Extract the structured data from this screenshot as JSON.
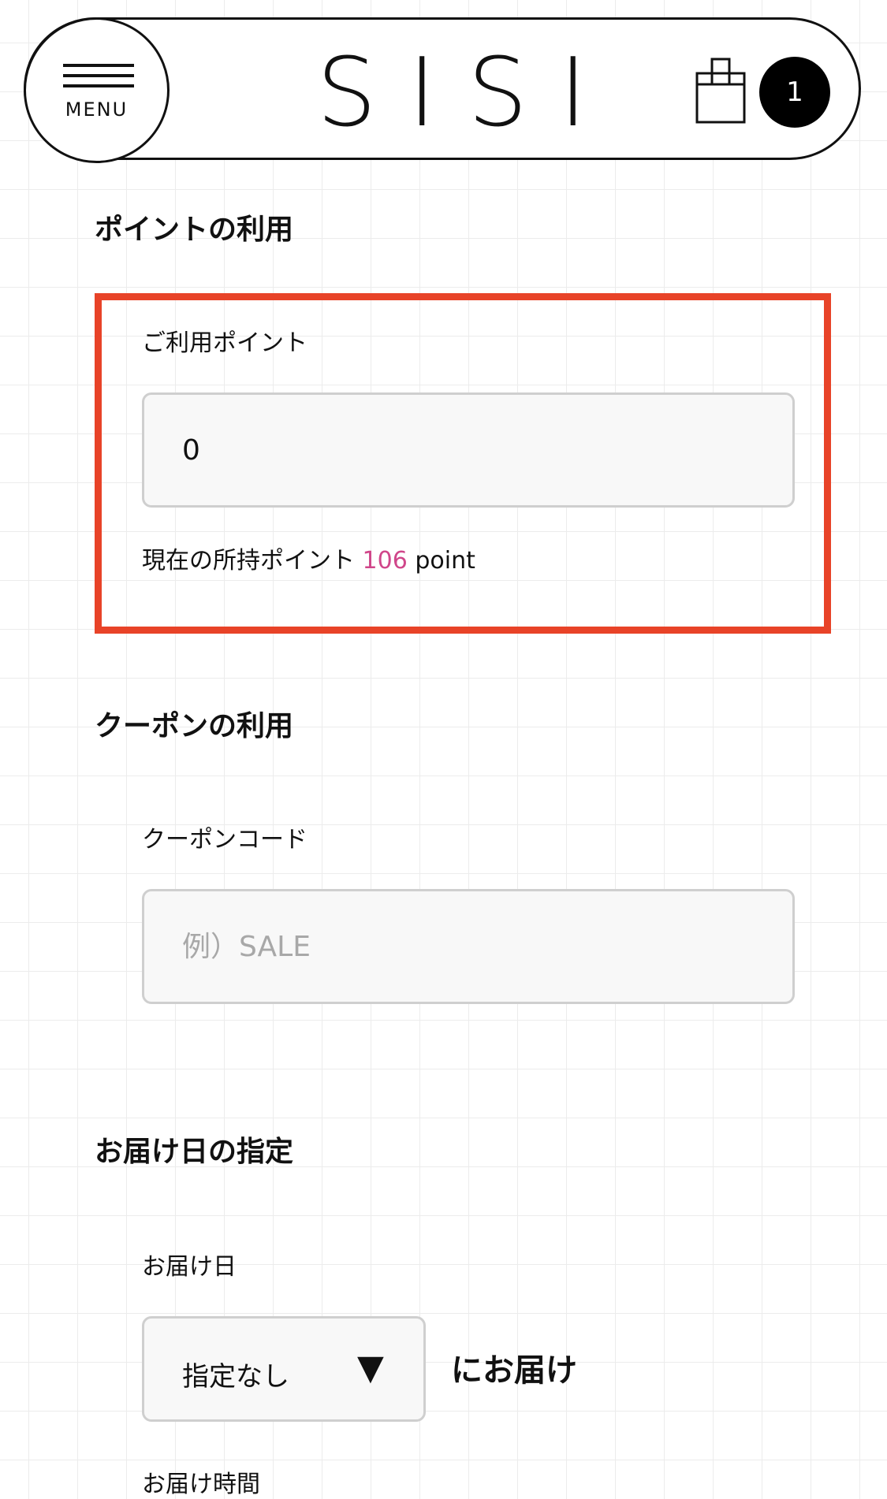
{
  "header": {
    "menu_label": "MENU",
    "brand": "SISI",
    "cart_count": "1",
    "bag_icon": "shopping-bag-icon",
    "menu_icon": "hamburger-icon"
  },
  "points": {
    "section_title": "ポイントの利用",
    "field_label": "ご利用ポイント",
    "input_value": "0",
    "current_label": "現在の所持ポイント",
    "current_value": "106",
    "unit": "point",
    "highlight_color": "#e84328",
    "value_color": "#d0468a"
  },
  "coupon": {
    "section_title": "クーポンの利用",
    "field_label": "クーポンコード",
    "input_value": "",
    "placeholder": "例）SALE"
  },
  "delivery": {
    "section_title": "お届け日の指定",
    "date_label": "お届け日",
    "selected": "指定なし",
    "arrow_icon": "triangle-down-icon",
    "suffix": "にお届け",
    "next_label": "お届け時間"
  }
}
